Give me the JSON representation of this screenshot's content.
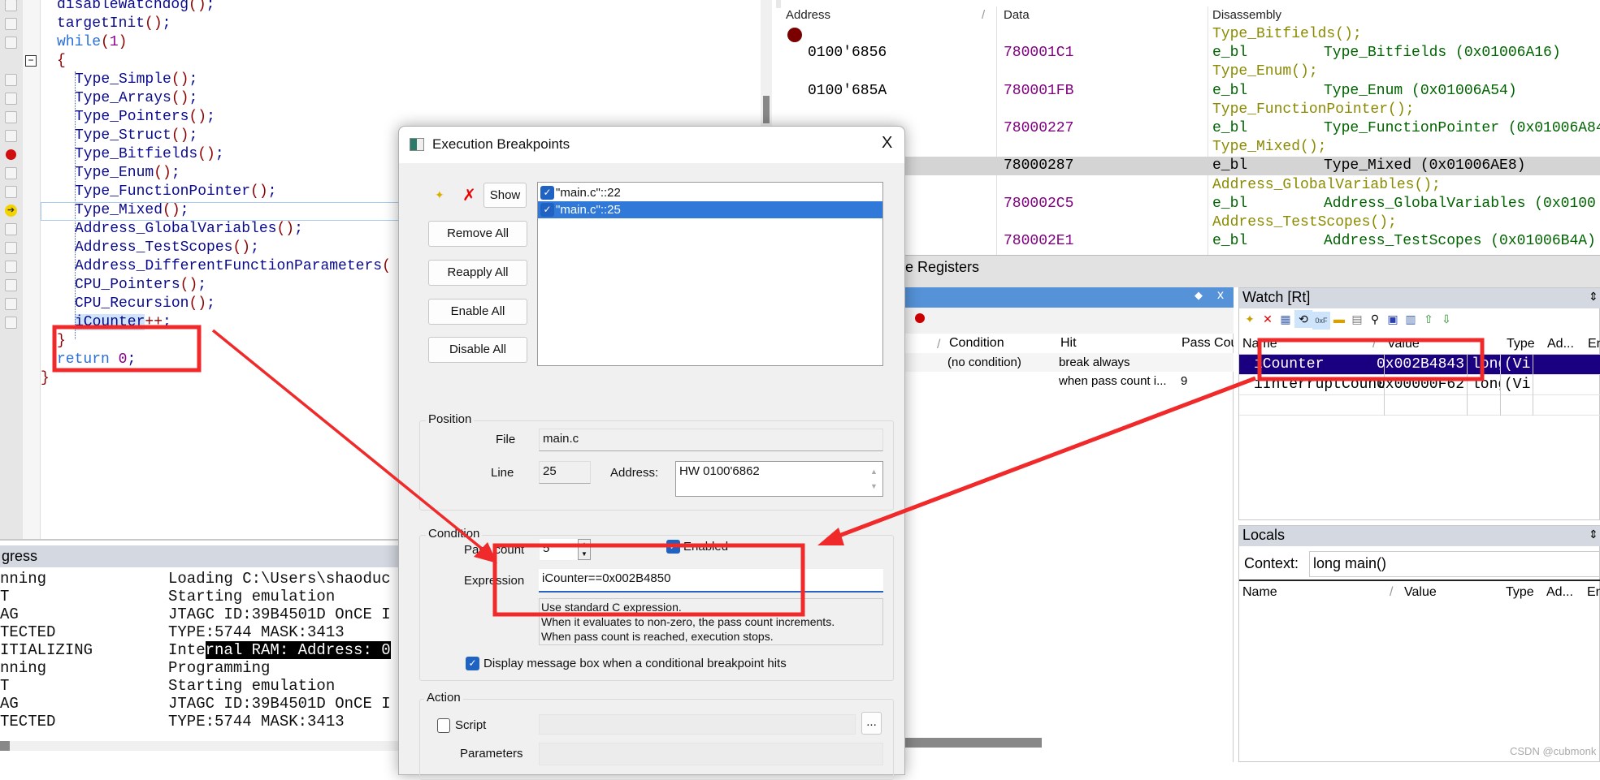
{
  "editor": {
    "lines": [
      {
        "text": "disableWatchdog();",
        "indent": 1
      },
      {
        "text": "targetInit();",
        "indent": 1
      },
      {
        "text": "while(1)",
        "indent": 1
      },
      {
        "text": "{",
        "indent": 1
      },
      {
        "text": "Type_Simple();",
        "indent": 2
      },
      {
        "text": "Type_Arrays();",
        "indent": 2
      },
      {
        "text": "Type_Pointers();",
        "indent": 2
      },
      {
        "text": "Type_Struct();",
        "indent": 2
      },
      {
        "text": "Type_Bitfields();",
        "indent": 2,
        "breakpoint": true
      },
      {
        "text": "Type_Enum();",
        "indent": 2
      },
      {
        "text": "Type_FunctionPointer();",
        "indent": 2
      },
      {
        "text": "Type_Mixed();",
        "indent": 2,
        "current": true
      },
      {
        "text": "Address_GlobalVariables();",
        "indent": 2
      },
      {
        "text": "Address_TestScopes();",
        "indent": 2
      },
      {
        "text": "Address_DifferentFunctionParameters(",
        "indent": 2
      },
      {
        "text": "CPU_Pointers();",
        "indent": 2
      },
      {
        "text": "CPU_Recursion();",
        "indent": 2
      },
      {
        "text": "iCounter++;",
        "indent": 2
      },
      {
        "text": "}",
        "indent": 1
      },
      {
        "text": "return 0;",
        "indent": 1
      },
      {
        "text": "}",
        "indent": 0
      }
    ],
    "colors": {
      "identifier": "#0a0a8c",
      "keyword": "#2a6fd6",
      "number": "#8a008a",
      "operator": "#8b0000"
    }
  },
  "disassembly": {
    "headers": {
      "address": "Address",
      "sort": "/",
      "data": "Data",
      "disassembly": "Disassembly"
    },
    "rows": [
      {
        "src": "Type_Bitfields();",
        "bp": true
      },
      {
        "addr": "0100'6856",
        "data": "780001C1",
        "op": "e_bl",
        "target": "Type_Bitfields (0x01006A16)"
      },
      {
        "src": "Type_Enum();"
      },
      {
        "addr": "0100'685A",
        "data": "780001FB",
        "op": "e_bl",
        "target": "Type_Enum (0x01006A54)"
      },
      {
        "src": "Type_FunctionPointer();"
      },
      {
        "addr": "",
        "data": "78000227",
        "op": "e_bl",
        "target": "Type_FunctionPointer (0x01006A84"
      },
      {
        "src": "Type_Mixed();"
      },
      {
        "addr": "",
        "data": "78000287",
        "op": "e_bl",
        "target": "Type_Mixed (0x01006AE8)",
        "current": true
      },
      {
        "src": "Address_GlobalVariables();"
      },
      {
        "addr": "",
        "data": "780002C5",
        "op": "e_bl",
        "target": "Address_GlobalVariables (0x0100"
      },
      {
        "src": "Address_TestScopes();"
      },
      {
        "addr": "",
        "data": "780002E1",
        "op": "e_bl",
        "target": "Address_TestScopes (0x01006B4A)"
      }
    ],
    "colors": {
      "source": "#8a8a00",
      "op": "#006400",
      "data": "#800080"
    }
  },
  "tabs": {
    "registers": "ore Registers"
  },
  "breakpoints_panel": {
    "headers": {
      "sort": "/",
      "condition": "Condition",
      "hit": "Hit",
      "pass_count": "Pass Cou"
    },
    "rows": [
      {
        "condition": "(no condition)",
        "hit": "break always",
        "pass_count": ""
      },
      {
        "condition": "",
        "hit": "when pass count i...",
        "pass_count": "9"
      }
    ]
  },
  "watch": {
    "title": "Watch [Rt]",
    "headers": {
      "name": "Name",
      "sort": "/",
      "value": "Value",
      "type": "Type",
      "address": "Ad...",
      "extra": "En"
    },
    "rows": [
      {
        "name": "iCounter",
        "value": "0x002B4843",
        "type": "long",
        "address": "(Vi",
        "selected": true
      },
      {
        "name": "iInterruptCount",
        "value": "0x00000F62",
        "type": "long",
        "address": "(Vi"
      }
    ]
  },
  "locals": {
    "title": "Locals",
    "context_label": "Context:",
    "context_value": "long main()",
    "headers": {
      "name": "Name",
      "sort": "/",
      "value": "Value",
      "type": "Type",
      "address": "Ad...",
      "extra": "En"
    }
  },
  "progress": {
    "title": "gress",
    "lines": [
      [
        "nning",
        "Loading C:\\Users\\shaoduc"
      ],
      [
        "T",
        "Starting emulation"
      ],
      [
        "AG",
        "JTAGC ID:39B4501D OnCE I"
      ],
      [
        "TECTED",
        "TYPE:5744 MASK:3413"
      ],
      [
        "ITIALIZING",
        "Internal RAM: Address: 0"
      ],
      [
        "nning",
        "Programming"
      ],
      [
        "T",
        "Starting emulation"
      ],
      [
        "AG",
        "JTAGC ID:39B4501D OnCE I"
      ],
      [
        "TECTED",
        "TYPE:5744 MASK:3413"
      ]
    ]
  },
  "dialog": {
    "title": "Execution Breakpoints",
    "close": "X",
    "show_button": "Show",
    "list": [
      {
        "label": "\"main.c\"::22",
        "checked": true
      },
      {
        "label": "\"main.c\"::25",
        "checked": true,
        "selected": true
      }
    ],
    "buttons": {
      "remove_all": "Remove All",
      "reapply_all": "Reapply All",
      "enable_all": "Enable All",
      "disable_all": "Disable All"
    },
    "position": {
      "legend": "Position",
      "file_label": "File",
      "file": "main.c",
      "line_label": "Line",
      "line": "25",
      "address_label": "Address:",
      "address": "HW 0100'6862"
    },
    "condition": {
      "legend": "Condition",
      "pass_count_label": "Pass count",
      "pass_count": "5",
      "enabled_label": "Enabled",
      "enabled": true,
      "expression_label": "Expression",
      "expression": "iCounter==0x002B4850",
      "help": [
        "Use standard C expression.",
        "When it evaluates to non-zero, the pass count increments.",
        "When pass count is reached, execution stops."
      ],
      "display_msg_label": "Display message box when a conditional breakpoint hits",
      "display_msg": true
    },
    "action": {
      "legend": "Action",
      "script_label": "Script",
      "script": false,
      "browse": "...",
      "parameters_label": "Parameters"
    }
  },
  "annotation_color": "#f02a2a",
  "watermark": "CSDN @cubmonk"
}
